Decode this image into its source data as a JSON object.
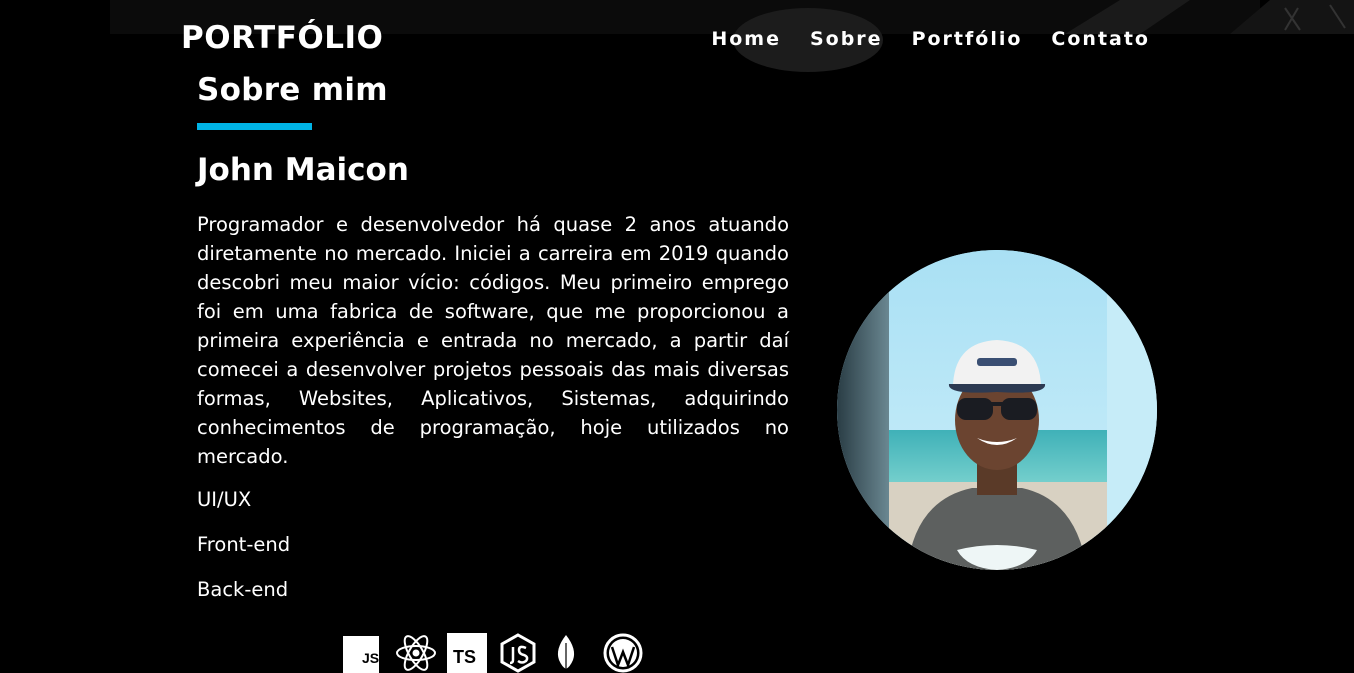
{
  "nav": {
    "brand": "PORTFÓLIO",
    "items": [
      {
        "label": "Home"
      },
      {
        "label": "Sobre"
      },
      {
        "label": "Portfólio"
      },
      {
        "label": "Contato"
      }
    ]
  },
  "about": {
    "section_title": "Sobre mim",
    "name": "John Maicon",
    "bio": "Programador e desenvolvedor há quase 2 anos atuando diretamente no mercado. Iniciei a carreira em 2019 quando descobri meu maior vício: códigos. Meu primeiro emprego foi em uma fabrica de software, que me proporcionou a primeira experiência e entrada no mercado, a partir daí comecei a desenvolver projetos pessoais das mais diversas formas, Websites, Aplicativos, Sistemas, adquirindo conhecimentos de programação, hoje utilizados no mercado.",
    "skills": [
      "UI/UX",
      "Front-end",
      "Back-end"
    ],
    "tech_icons": [
      "javascript-icon",
      "react-icon",
      "typescript-icon",
      "nodejs-icon",
      "mongodb-icon",
      "wordpress-icon"
    ],
    "tech_labels": [
      "JS",
      "TS"
    ]
  },
  "colors": {
    "accent": "#00b4e6",
    "background": "#000000",
    "text": "#ffffff"
  }
}
